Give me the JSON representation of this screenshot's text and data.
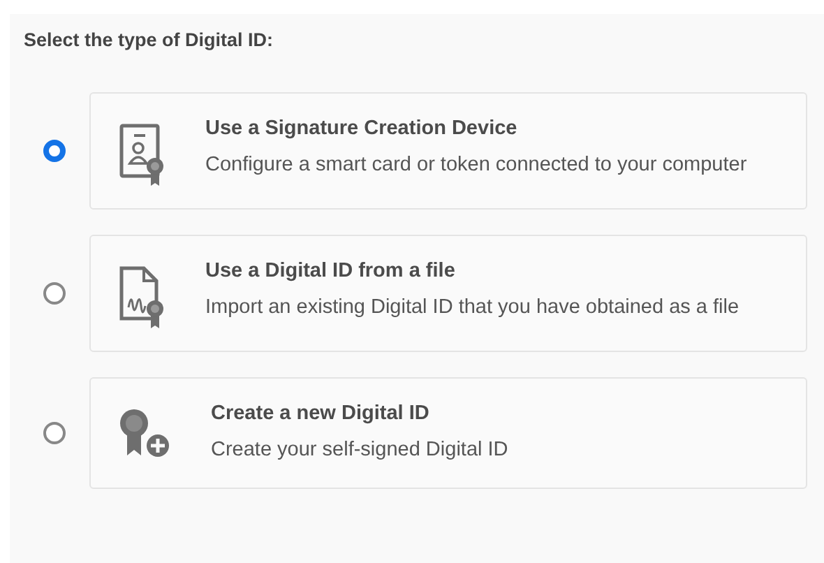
{
  "heading": "Select the type of Digital ID:",
  "options": [
    {
      "kind": "device",
      "title": "Use a Signature Creation Device",
      "description": "Configure a smart card or token connected to your computer",
      "selected": true
    },
    {
      "kind": "file",
      "title": "Use a Digital ID from a file",
      "description": "Import an existing Digital ID that you have obtained as a file",
      "selected": false
    },
    {
      "kind": "new",
      "title": "Create a new Digital ID",
      "description": "Create your self-signed Digital ID",
      "selected": false
    }
  ]
}
